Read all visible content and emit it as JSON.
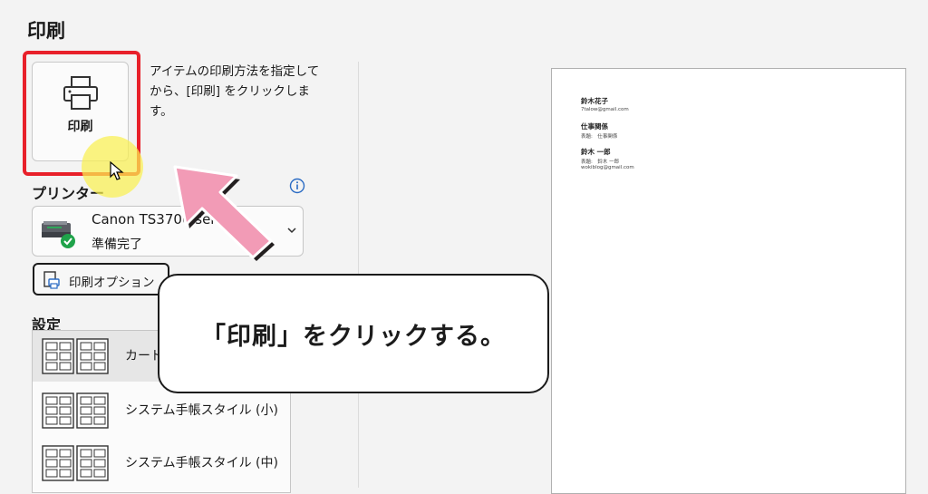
{
  "page": {
    "title": "印刷"
  },
  "print_button": {
    "label": "印刷",
    "icon": "printer-icon"
  },
  "help_text": "アイテムの印刷方法を指定してから、[印刷] をクリックします。",
  "printer": {
    "section_label": "プリンター",
    "name": "Canon TS3700 seri",
    "status": "準備完了",
    "status_color": "#1fa34a"
  },
  "options_button": {
    "label": "印刷オプション"
  },
  "settings": {
    "section_label": "設定",
    "layouts": [
      {
        "label": "カード"
      },
      {
        "label": "システム手帳スタイル (小)"
      },
      {
        "label": "システム手帳スタイル (中)"
      }
    ]
  },
  "preview": {
    "entries": [
      {
        "name": "鈴木花子",
        "lines": [
          "7talow@gmail.com"
        ]
      },
      {
        "name": "仕事関係",
        "lines": [
          "表題:　仕事関係"
        ]
      },
      {
        "name": "鈴木 一郎",
        "lines": [
          "表題:　鈴木 一郎",
          "wokiblog@gmail.com"
        ]
      }
    ]
  },
  "callout": {
    "text": "「印刷」をクリックする。"
  },
  "colors": {
    "highlight_red": "#e8202a",
    "cursor_glow": "#faf050",
    "arrow_pink": "#f29bb6"
  }
}
